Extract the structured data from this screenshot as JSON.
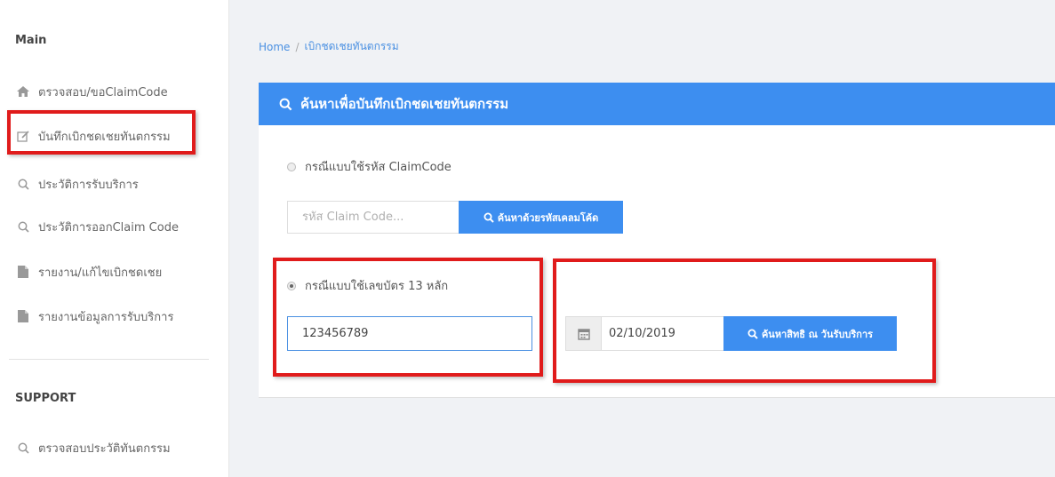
{
  "sidebar": {
    "main_title": "Main",
    "support_title": "SUPPORT",
    "items": [
      {
        "label": "ตรวจสอบ/ขอClaimCode",
        "icon": "home-icon"
      },
      {
        "label": "บันทึกเบิกชดเชยทันตกรรม",
        "icon": "edit-icon"
      },
      {
        "label": "ประวัติการรับบริการ",
        "icon": "search-icon"
      },
      {
        "label": "ประวัติการออกClaim Code",
        "icon": "search-icon"
      },
      {
        "label": "รายงาน/แก้ไขเบิกชดเชย",
        "icon": "file-icon"
      },
      {
        "label": "รายงานข้อมูลการรับบริการ",
        "icon": "file-icon"
      }
    ],
    "support_items": [
      {
        "label": "ตรวจสอบประวัติทันตกรรม",
        "icon": "search-icon"
      }
    ]
  },
  "breadcrumb": {
    "home": "Home",
    "separator": "/",
    "current": "เบิกชดเชยทันตกรรม"
  },
  "panel": {
    "title": "ค้นหาเพื่อบันทึกเบิกชดเชยทันตกรรม",
    "claim_option": {
      "label": "กรณีแบบใช้รหัส ClaimCode",
      "checked": false,
      "input_placeholder": "รหัส Claim Code...",
      "input_value": "",
      "button_label": "ค้นหาด้วยรหัสเคลมโค้ด"
    },
    "id_option": {
      "label": "กรณีแบบใช้เลขบัตร 13 หลัก",
      "checked": true,
      "input_value": "123456789",
      "date_value": "02/10/2019",
      "button_label": "ค้นหาสิทธิ ณ วันรับบริการ"
    }
  },
  "colors": {
    "accent": "#3d8ef0",
    "highlight": "#e01b1b"
  }
}
